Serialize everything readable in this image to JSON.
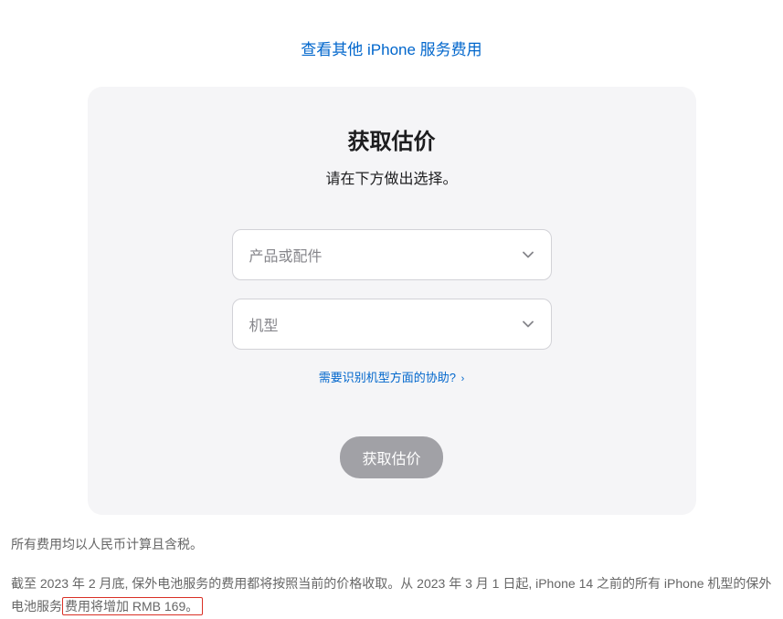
{
  "top_link": {
    "text": "查看其他 iPhone 服务费用"
  },
  "card": {
    "title": "获取估价",
    "subtitle": "请在下方做出选择。",
    "product_select": {
      "placeholder": "产品或配件"
    },
    "model_select": {
      "placeholder": "机型"
    },
    "help_link": {
      "text": "需要识别机型方面的协助?",
      "arrow": "›"
    },
    "submit_button": "获取估价"
  },
  "footer": {
    "line1": "所有费用均以人民币计算且含税。",
    "line2_pre": "截至 2023 年 2 月底, 保外电池服务的费用都将按照当前的价格收取。从 2023 年 3 月 1 日起, iPhone 14 之前的所有 iPhone 机型的保外电池服务",
    "line2_highlight": "费用将增加 RMB 169。"
  }
}
